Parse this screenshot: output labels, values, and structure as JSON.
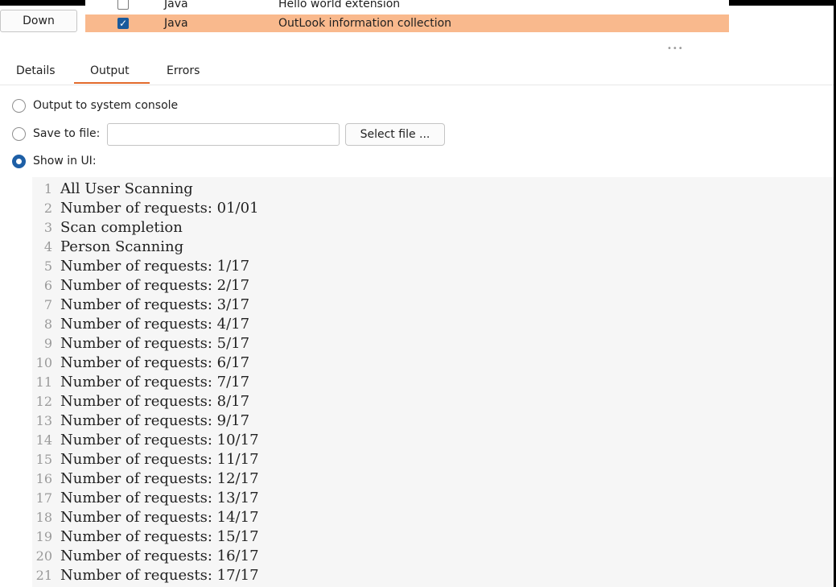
{
  "top": {
    "down_button": "Down",
    "extensions": [
      {
        "type": "Java",
        "name": "Hello world extension",
        "checked": false
      },
      {
        "type": "Java",
        "name": "OutLook information collection",
        "checked": true,
        "selected": true
      }
    ],
    "selection_color": "#f9b98d"
  },
  "tabs": [
    {
      "label": "Details",
      "active": false
    },
    {
      "label": "Output",
      "active": true
    },
    {
      "label": "Errors",
      "active": false
    }
  ],
  "accent_color": "#e26b2c",
  "output_options": {
    "system_console": {
      "label": "Output to system console",
      "selected": false
    },
    "save_to_file": {
      "label": "Save to file:",
      "selected": false,
      "value": "",
      "select_button": "Select file ..."
    },
    "show_in_ui": {
      "label": "Show in UI:",
      "selected": true
    }
  },
  "output_lines": [
    {
      "n": "1",
      "text": "All User Scanning"
    },
    {
      "n": "2",
      "text": "Number of requests: 01/01"
    },
    {
      "n": "3",
      "text": "Scan completion"
    },
    {
      "n": "4",
      "text": "Person Scanning"
    },
    {
      "n": "5",
      "text": "Number of requests: 1/17"
    },
    {
      "n": "6",
      "text": "Number of requests: 2/17"
    },
    {
      "n": "7",
      "text": "Number of requests: 3/17"
    },
    {
      "n": "8",
      "text": "Number of requests: 4/17"
    },
    {
      "n": "9",
      "text": "Number of requests: 5/17"
    },
    {
      "n": "10",
      "text": "Number of requests: 6/17"
    },
    {
      "n": "11",
      "text": "Number of requests: 7/17"
    },
    {
      "n": "12",
      "text": "Number of requests: 8/17"
    },
    {
      "n": "13",
      "text": "Number of requests: 9/17"
    },
    {
      "n": "14",
      "text": "Number of requests: 10/17"
    },
    {
      "n": "15",
      "text": "Number of requests: 11/17"
    },
    {
      "n": "16",
      "text": "Number of requests: 12/17"
    },
    {
      "n": "17",
      "text": "Number of requests: 13/17"
    },
    {
      "n": "18",
      "text": "Number of requests: 14/17"
    },
    {
      "n": "19",
      "text": "Number of requests: 15/17"
    },
    {
      "n": "20",
      "text": "Number of requests: 16/17"
    },
    {
      "n": "21",
      "text": "Number of requests: 17/17"
    }
  ]
}
